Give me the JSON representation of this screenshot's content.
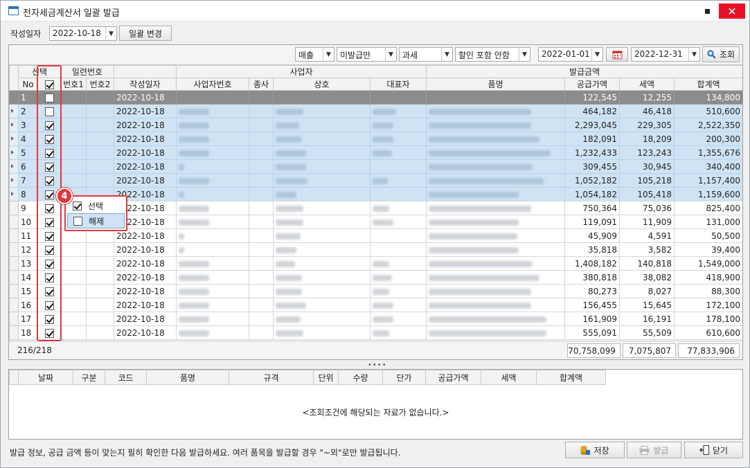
{
  "window": {
    "title": "전자세금계산서 일괄 발급"
  },
  "toolbar": {
    "date_label": "작성일자",
    "date_value": "2022-10-18",
    "bulk_change_label": "일괄 변경"
  },
  "filters": {
    "type": "매출",
    "status": "미발급만",
    "tax": "과세",
    "discount": "할인 포함 안함",
    "date_from": "2022-01-01",
    "date_to": "2022-12-31",
    "search_label": "조회"
  },
  "grid": {
    "group_headers": {
      "select": "선택",
      "serial": "일련번호",
      "business": "사업자",
      "amount": "발급금액"
    },
    "columns": {
      "no": "No",
      "serial1": "번호1",
      "serial2": "번호2",
      "date": "작성일자",
      "biz_no": "사업자번호",
      "branch": "종사",
      "company": "상호",
      "ceo": "대표자",
      "item": "품명",
      "supply": "공급가액",
      "tax": "세액",
      "total": "합계액"
    },
    "rows": [
      {
        "no": "1",
        "checked": false,
        "date": "2022-10-18",
        "supply": "122,545",
        "tax": "12,255",
        "total": "134,800"
      },
      {
        "no": "2",
        "checked": false,
        "date": "2022-10-18",
        "supply": "464,182",
        "tax": "46,418",
        "total": "510,600"
      },
      {
        "no": "3",
        "checked": true,
        "date": "2022-10-18",
        "supply": "2,293,045",
        "tax": "229,305",
        "total": "2,522,350"
      },
      {
        "no": "4",
        "checked": true,
        "date": "2022-10-18",
        "supply": "182,091",
        "tax": "18,209",
        "total": "200,300"
      },
      {
        "no": "5",
        "checked": true,
        "date": "2022-10-18",
        "supply": "1,232,433",
        "tax": "123,243",
        "total": "1,355,676"
      },
      {
        "no": "6",
        "checked": true,
        "date": "2022-10-18",
        "supply": "309,455",
        "tax": "30,945",
        "total": "340,400"
      },
      {
        "no": "7",
        "checked": true,
        "date": "2022-10-18",
        "supply": "1,052,182",
        "tax": "105,218",
        "total": "1,157,400"
      },
      {
        "no": "8",
        "checked": true,
        "date": "2022-10-18",
        "supply": "1,054,182",
        "tax": "105,418",
        "total": "1,159,600"
      },
      {
        "no": "9",
        "checked": true,
        "date": "2022-10-18",
        "supply": "750,364",
        "tax": "75,036",
        "total": "825,400"
      },
      {
        "no": "10",
        "checked": true,
        "date": "2022-10-18",
        "supply": "119,091",
        "tax": "11,909",
        "total": "131,000"
      },
      {
        "no": "11",
        "checked": true,
        "date": "2022-10-18",
        "supply": "45,909",
        "tax": "4,591",
        "total": "50,500"
      },
      {
        "no": "12",
        "checked": true,
        "date": "2022-10-18",
        "supply": "35,818",
        "tax": "3,582",
        "total": "39,400"
      },
      {
        "no": "13",
        "checked": true,
        "date": "2022-10-18",
        "supply": "1,408,182",
        "tax": "140,818",
        "total": "1,549,000"
      },
      {
        "no": "14",
        "checked": true,
        "date": "2022-10-18",
        "supply": "380,818",
        "tax": "38,082",
        "total": "418,900"
      },
      {
        "no": "15",
        "checked": true,
        "date": "2022-10-18",
        "supply": "80,273",
        "tax": "8,027",
        "total": "88,300"
      },
      {
        "no": "16",
        "checked": true,
        "date": "2022-10-18",
        "supply": "156,455",
        "tax": "15,645",
        "total": "172,100"
      },
      {
        "no": "17",
        "checked": true,
        "date": "2022-10-18",
        "supply": "161,909",
        "tax": "16,191",
        "total": "178,100"
      },
      {
        "no": "18",
        "checked": true,
        "date": "2022-10-18",
        "supply": "555,091",
        "tax": "55,509",
        "total": "610,600"
      }
    ]
  },
  "summary": {
    "count": "216/218",
    "supply_total": "70,758,099",
    "tax_total": "7,075,807",
    "grand_total": "77,833,906"
  },
  "popup": {
    "badge": "4",
    "select_label": "선택",
    "deselect_label": "해제"
  },
  "detail": {
    "columns": [
      "날짜",
      "구분",
      "코드",
      "품명",
      "규격",
      "단위",
      "수량",
      "단가",
      "공급가액",
      "세액",
      "합계액"
    ],
    "empty_message": "<조회조건에 해당되는 자료가 없습니다.>"
  },
  "footer": {
    "note": "발급 정보, 공급 금액 등이 맞는지 필히 확인한 다음 발급하세요. 여러 품목을 발급할 경우 \"~외\"로만 발급됩니다.",
    "save_label": "저장",
    "issue_label": "발급",
    "close_label": "닫기"
  },
  "colors": {
    "highlight_red": "#e0393b",
    "selection_blue": "#cfe3f4",
    "current_row_gray": "#8c8c8c",
    "close_button_red": "#e81123"
  }
}
